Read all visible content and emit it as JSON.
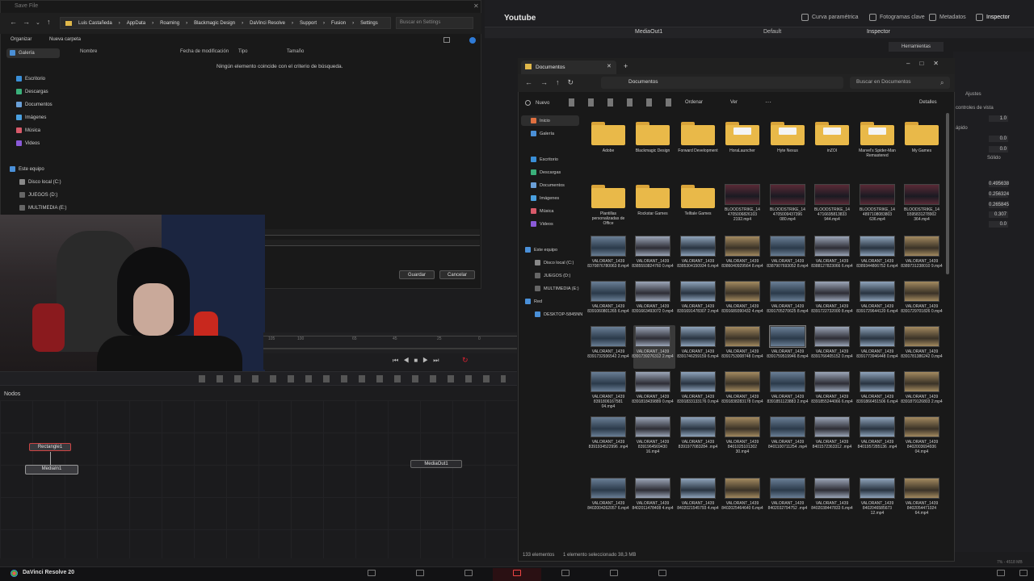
{
  "resolve": {
    "panel_title": "Youtube",
    "tools": [
      "Curva paramétrica",
      "Fotogramas clave",
      "Metadatos",
      "Inspector"
    ],
    "viewer_name": "MediaOut1",
    "viewer_mode": "Default",
    "inspector_title": "Inspector",
    "inspector_tab": "Herramientas",
    "inspector_extra": "Ajustes",
    "inspector_controls_label": "controles de vista",
    "inspector_rows": [
      "1.0",
      "0.0",
      "0.0",
      "0.495638",
      "0.256324",
      "0.265845",
      "0.307",
      "0.0"
    ],
    "inspector_labels": [
      "ápido",
      "Sólido"
    ],
    "nodes_header": "Nodos",
    "nodes": [
      "Rectangle1",
      "MediaIn1",
      "MediaOut1"
    ],
    "timeline_ticks": [
      "105",
      "100",
      "65",
      "45",
      "25",
      "0"
    ],
    "app_name": "DaVinci Resolve 20",
    "memory": "7% - 4518 MB"
  },
  "save_dialog": {
    "title": "Save File",
    "path": [
      "Luis Castañeda",
      "AppData",
      "Roaming",
      "Blackmagic Design",
      "DaVinci Resolve",
      "Support",
      "Fusion",
      "Settings"
    ],
    "search_placeholder": "Buscar en Settings",
    "organize": "Organizar",
    "new_folder": "Nueva carpeta",
    "sidebar": [
      "Galería",
      "Escritorio",
      "Descargas",
      "Documentos",
      "Imágenes",
      "Música",
      "Videos",
      "Este equipo",
      "Disco local (C:)",
      "JUEGOS (D:)",
      "MULTIMEDIA (E:)"
    ],
    "columns": [
      "Nombre",
      "Fecha de modificación",
      "Tipo",
      "Tamaño"
    ],
    "empty_message": "Ningún elemento coincide con el criterio de búsqueda.",
    "save_button": "Guardar",
    "cancel_button": "Cancelar"
  },
  "explorer": {
    "tab_title": "Documentos",
    "address": "Documentos",
    "search_placeholder": "Buscar en Documentos",
    "commands": [
      "Nuevo",
      "Ordenar",
      "Ver",
      "Detalles"
    ],
    "sidebar": [
      "Inicio",
      "Galería",
      "Escritorio",
      "Descargas",
      "Documentos",
      "Imágenes",
      "Música",
      "Videos",
      "Este equipo",
      "Disco local (C:)",
      "JUEGOS (D:)",
      "MULTIMEDIA (E:)",
      "Red",
      "DESKTOP-5845NN"
    ],
    "folders": [
      {
        "label": "Adobe"
      },
      {
        "label": "Blackmagic Design"
      },
      {
        "label": "Forward Development"
      },
      {
        "label": "HoraLauncher"
      },
      {
        "label": "Hyte Nexus"
      },
      {
        "label": "inZOI"
      },
      {
        "label": "Marvel's Spider-Man Remastered"
      },
      {
        "label": "My Games"
      },
      {
        "label": "Plantillas personalizadas de Office"
      },
      {
        "label": "Rockstar Games"
      },
      {
        "label": "Telltale Games"
      }
    ],
    "videos": [
      "BLOODSTRIKE_14 4705006826103 2192.mp4",
      "BLOODSTRIKE_14 4705009437396 080.mp4",
      "BLOODSTRIKE_14 4716695813833 944.mp4",
      "BLOODSTRIKE_14 4897108083803 636.mp4",
      "BLOODSTRIKE_14 5595831278902 364.mp4",
      "VALORANT_1439 8370876780063 8.mp4",
      "VALORANT_1439 8385593824760 0.mp4",
      "VALORANT_1439 8385304150934 6.mp4",
      "VALORANT_1439 8386040929564 8.mp4",
      "VALORANT_1439 8387907693052 8.mp4",
      "VALORANT_1439 8388127823066 6.mp4",
      "VALORANT_1439 8389344806752 6.mp4",
      "VALORANT_1439 8389731238010 9.mp4",
      "VALORANT_1439 8391060801265 6.mp4",
      "VALORANT_1439 8391663493072 0.mp4",
      "VALORANT_1439 8391691478307 2.mp4",
      "VALORANT_1439 8391689390432 4.mp4",
      "VALORANT_1439 8391705270625 8.mp4",
      "VALORANT_1439 8391722732000 8.mp4",
      "VALORANT_1439 8391729644120 6.mp4",
      "VALORANT_1439 8391729701826 0.mp4",
      "VALORANT_1439 8391732936542 2.mp4",
      "VALORANT_1439 8391739276312 2.mp4",
      "VALORANT_1439 8391746259159 6.mp4",
      "VALORANT_1439 8391753008748 0.mp4",
      "VALORANT_1439 8391759519946 8.mp4",
      "VALORANT_1439 8391766405152 0.mp4",
      "VALORANT_1439 8391773946448 0.mp4",
      "VALORANT_1439 8391781386242 0.mp4",
      "VALORANT_1439 8391806167581 04.mp4",
      "VALORANT_1439 8391818439889 0.mp4",
      "VALORANT_1439 8391833133176 0.mp4",
      "VALORANT_1439 8391838283178 0.mp4",
      "VALORANT_1439 8391851123883 2.mp4",
      "VALORANT_1439 8391855244066 6.mp4",
      "VALORANT_1439 8391866451506 6.mp4",
      "VALORANT_1439 8391879126803 2.mp4",
      "VALORANT_1439 8391934522996 .mp4",
      "VALORANT_1439 8391964569430 16.mp4",
      "VALORANT_1439 8391977083284 .mp4",
      "VALORANT_1439 8401025101302 30.mp4",
      "VALORANT_1439 8401100711254 .mp4",
      "VALORANT_1439 8401572363312 .mp4",
      "VALORANT_1439 8401957285136 .mp4",
      "VALORANT_1439 8402003694936 04.mp4",
      "VALORANT_1439 8402004262057 6.mp4",
      "VALORANT_1439 8402011478408 4.mp4",
      "VALORANT_1439 8402021545793 4.mp4",
      "VALORANT_1439 8402025464640 6.mp4",
      "VALORANT_1439 8402032794752 .mp4",
      "VALORANT_1439 8402038447833 6.mp4",
      "VALORANT_1439 8402046585673 12.mp4",
      "VALORANT_1439 8402054471024 64.mp4"
    ],
    "status_count": "133 elementos",
    "status_selected": "1 elemento seleccionado  38,3 MB"
  }
}
